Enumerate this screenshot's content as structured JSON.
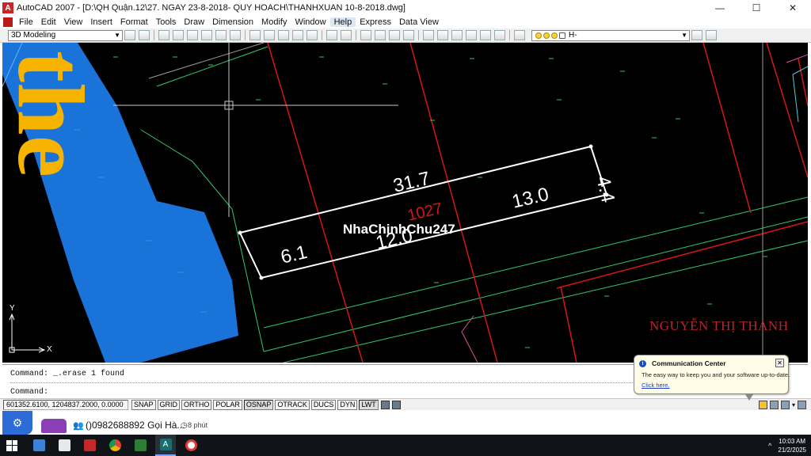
{
  "window": {
    "title": "AutoCAD 2007 - [D:\\QH Quận.12\\27. NGAY 23-8-2018- QUY HOACH\\THANHXUAN 10-8-2018.dwg]",
    "app_icon": "autocad-logo-icon",
    "controls": {
      "minimize": "—",
      "maximize": "☐",
      "close": "✕"
    }
  },
  "menu": {
    "items": [
      "File",
      "Edit",
      "View",
      "Insert",
      "Format",
      "Tools",
      "Draw",
      "Dimension",
      "Modify",
      "Window",
      "Help",
      "Express",
      "Data View"
    ],
    "active": "Help"
  },
  "toolbar": {
    "workspace": "3D Modeling",
    "layer": "H-"
  },
  "drawing": {
    "dimensions": {
      "top": "31.7",
      "right": "4.4",
      "left": "6.1",
      "segment_right": "13.0",
      "segment_mid": "12.0"
    },
    "parcel_number": "1027",
    "watermark": "NhaChinhChu247",
    "owner_label": "NGUYỄN THỊ THANH",
    "street_label": "the",
    "ucs": {
      "x": "X",
      "y": "Y"
    },
    "colors": {
      "background": "#000000",
      "parcel_red": "#d51616",
      "road_blue": "#1a73d9",
      "street_text": "#f6b300"
    }
  },
  "command": {
    "history": "Command: _.erase 1 found",
    "prompt": "Command:"
  },
  "statusbar": {
    "coordinates": "601352.6100, 1204837.2000, 0.0000",
    "toggles": [
      "SNAP",
      "GRID",
      "ORTHO",
      "POLAR",
      "OSNAP",
      "OTRACK",
      "DUCS",
      "DYN",
      "LWT"
    ]
  },
  "notification": {
    "title": "Communication Center",
    "body": "The easy way to keep you and your software up-to-date.",
    "link": "Click here."
  },
  "overlay": {
    "phone": "()0982688892 Gọi Hà...",
    "time_ago": "8 phút"
  },
  "taskbar": {
    "time": "10:03 AM",
    "date": "21/2/2025"
  }
}
